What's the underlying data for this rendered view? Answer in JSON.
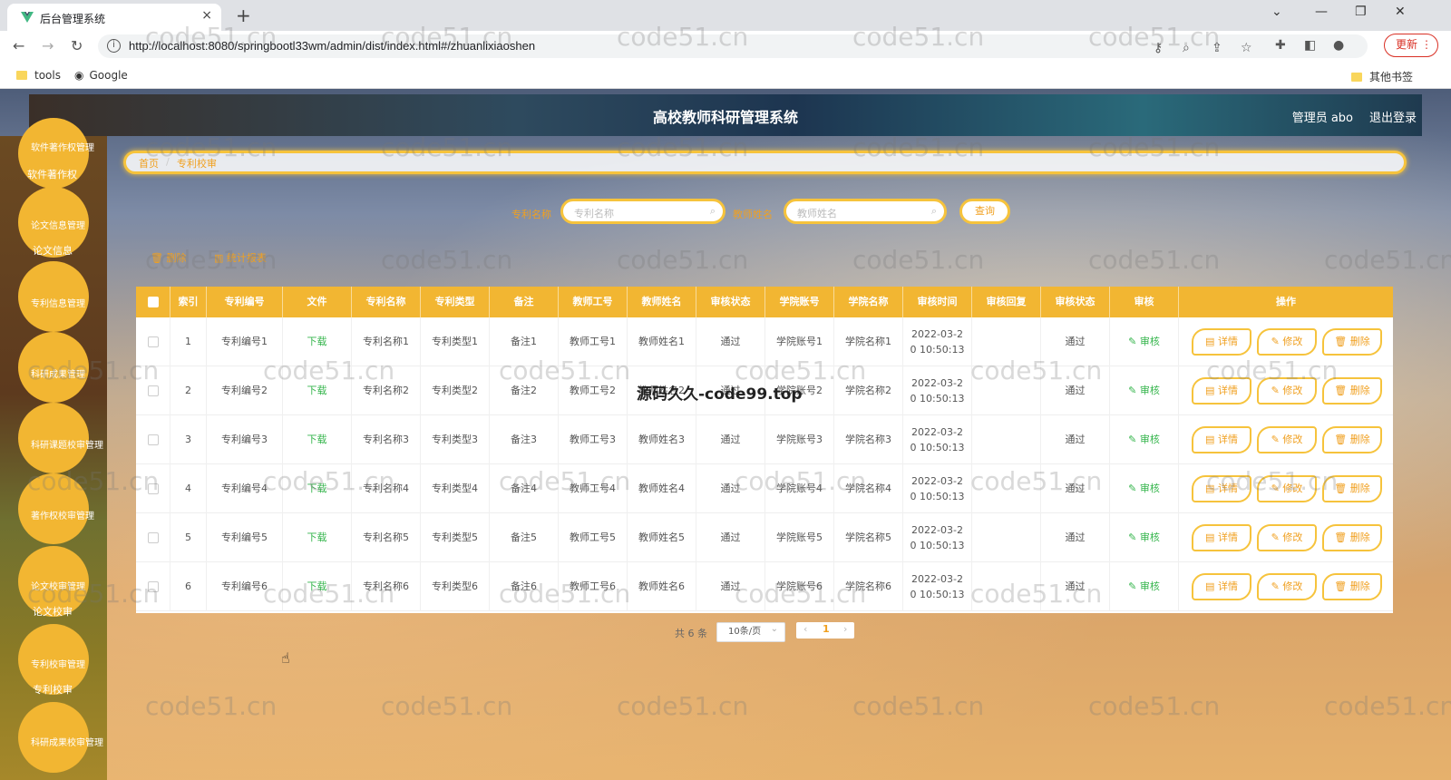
{
  "browser": {
    "tab_title": "后台管理系统",
    "tab_close": "×",
    "new_tab": "+",
    "url": "http://localhost:8080/springbootl33wm/admin/dist/index.html#/zhuanlixiaoshen",
    "update_label": "更新",
    "bookmarks": [
      {
        "label": "tools",
        "icon": "folder-icon"
      },
      {
        "label": "Google",
        "icon": "globe-icon"
      }
    ],
    "other_bookmarks": "其他书签"
  },
  "app": {
    "title": "高校教师科研管理系统",
    "admin_label": "管理员 abo",
    "logout_label": "退出登录"
  },
  "sidebar": {
    "items": [
      {
        "label": "软件著作权管理"
      },
      {
        "label": "软件著作权"
      },
      {
        "label": "论文信息管理"
      },
      {
        "label": "论文信息"
      },
      {
        "label": "专利信息管理"
      },
      {
        "label": "科研成果管理"
      },
      {
        "label": "科研课题校审管理"
      },
      {
        "label": "著作权校审管理"
      },
      {
        "label": "论文校审管理"
      },
      {
        "label": "论文校审"
      },
      {
        "label": "专利校审管理"
      },
      {
        "label": "专利校审"
      },
      {
        "label": "科研成果校审管理"
      }
    ]
  },
  "breadcrumb": {
    "home": "首页",
    "sep": "/",
    "current": "专利校审"
  },
  "search": {
    "patent_label": "专利名称",
    "patent_placeholder": "专利名称",
    "teacher_label": "教师姓名",
    "teacher_placeholder": "教师姓名",
    "query_label": "查询"
  },
  "actions": {
    "delete_label": "删除",
    "stats_label": "统计报表"
  },
  "table": {
    "headers": [
      "索引",
      "专利编号",
      "文件",
      "专利名称",
      "专利类型",
      "备注",
      "教师工号",
      "教师姓名",
      "审核状态",
      "学院账号",
      "学院名称",
      "审核时间",
      "审核回复",
      "审核状态",
      "审核",
      "操作"
    ],
    "rows": [
      {
        "index": "1",
        "code": "专利编号1",
        "file": "下载",
        "name": "专利名称1",
        "type": "专利类型1",
        "note": "备注1",
        "tid": "教师工号1",
        "tname": "教师姓名1",
        "status": "通过",
        "college_acc": "学院账号1",
        "college": "学院名称1",
        "time1": "2022-03-2",
        "time2": "0 10:50:13",
        "reply": "",
        "status2": "通过",
        "audit": "审核"
      },
      {
        "index": "2",
        "code": "专利编号2",
        "file": "下载",
        "name": "专利名称2",
        "type": "专利类型2",
        "note": "备注2",
        "tid": "教师工号2",
        "tname": "教师姓名2",
        "status": "通过",
        "college_acc": "学院账号2",
        "college": "学院名称2",
        "time1": "2022-03-2",
        "time2": "0 10:50:13",
        "reply": "",
        "status2": "通过",
        "audit": "审核"
      },
      {
        "index": "3",
        "code": "专利编号3",
        "file": "下载",
        "name": "专利名称3",
        "type": "专利类型3",
        "note": "备注3",
        "tid": "教师工号3",
        "tname": "教师姓名3",
        "status": "通过",
        "college_acc": "学院账号3",
        "college": "学院名称3",
        "time1": "2022-03-2",
        "time2": "0 10:50:13",
        "reply": "",
        "status2": "通过",
        "audit": "审核"
      },
      {
        "index": "4",
        "code": "专利编号4",
        "file": "下载",
        "name": "专利名称4",
        "type": "专利类型4",
        "note": "备注4",
        "tid": "教师工号4",
        "tname": "教师姓名4",
        "status": "通过",
        "college_acc": "学院账号4",
        "college": "学院名称4",
        "time1": "2022-03-2",
        "time2": "0 10:50:13",
        "reply": "",
        "status2": "通过",
        "audit": "审核"
      },
      {
        "index": "5",
        "code": "专利编号5",
        "file": "下载",
        "name": "专利名称5",
        "type": "专利类型5",
        "note": "备注5",
        "tid": "教师工号5",
        "tname": "教师姓名5",
        "status": "通过",
        "college_acc": "学院账号5",
        "college": "学院名称5",
        "time1": "2022-03-2",
        "time2": "0 10:50:13",
        "reply": "",
        "status2": "通过",
        "audit": "审核"
      },
      {
        "index": "6",
        "code": "专利编号6",
        "file": "下载",
        "name": "专利名称6",
        "type": "专利类型6",
        "note": "备注6",
        "tid": "教师工号6",
        "tname": "教师姓名6",
        "status": "通过",
        "college_acc": "学院账号6",
        "college": "学院名称6",
        "time1": "2022-03-2",
        "time2": "0 10:50:13",
        "reply": "",
        "status2": "通过",
        "audit": "审核"
      }
    ],
    "op_labels": {
      "detail": "详情",
      "edit": "修改",
      "delete": "删除"
    }
  },
  "pagination": {
    "total": "共 6 条",
    "page_size": "10条/页",
    "current": "1",
    "prev": "‹",
    "next": "›"
  },
  "watermarks": {
    "site": "code51.cn",
    "center": "源码久久-code99.top"
  },
  "colors": {
    "accent": "#f2b632",
    "link": "#f0a020",
    "green": "#35b54c"
  }
}
